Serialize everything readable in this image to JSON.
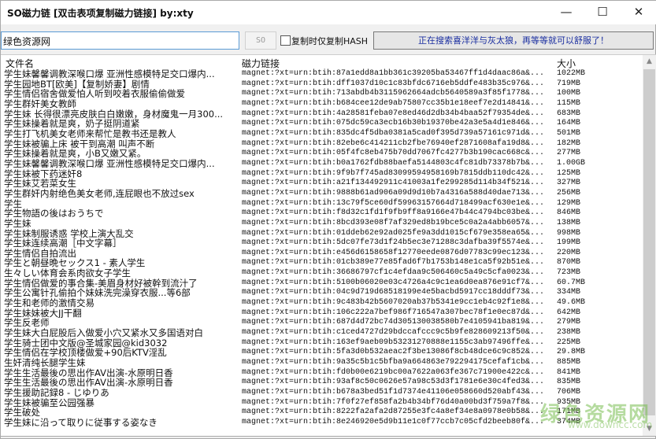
{
  "window": {
    "title": "SO磁力链 [双击表项复制磁力链接] by:xty",
    "minimize": "—",
    "maximize": "☐",
    "close": "✕"
  },
  "toolbar": {
    "search_value": "绿色资源网",
    "so_label": "SO",
    "checkbox_label": "复制时仅复制HASH",
    "checked": false,
    "status": "正在搜索喜洋洋与灰太狼，再等等就可以舒服了！"
  },
  "columns": {
    "name": "文件名",
    "magnet": "磁力链接",
    "size": "大小"
  },
  "rows": [
    {
      "name": "学生妹馨馨调教深喉口爆 亚洲性感模特足交口爆内...",
      "magnet": "magnet:?xt=urn:btih:87a1edd8a1bb361c39205ba53467ff1d4daac86a&...",
      "size": "1022MB"
    },
    {
      "name": "学生园地BT[欧美]【复制娇妻】剧情",
      "magnet": "magnet:?xt=urn:btih:dff1037d10c1c83bfdc6716eb5ddfe483b35c976&...",
      "size": "719MB"
    },
    {
      "name": "学生情侣宿舍做爱怕人听到咬着衣服偷偷做爱",
      "magnet": "magnet:?xt=urn:btih:713abdb4b3115962664adcb5640589a3f85f1778&...",
      "size": "100MB"
    },
    {
      "name": "学生群奸美女教師",
      "magnet": "magnet:?xt=urn:btih:b684cee12de9ab75807cc35b1e18eef7e2d14841&...",
      "size": "115MB"
    },
    {
      "name": "学生妹 长得很漂亮皮肤白白嫩嫩，身材魔鬼一月300...",
      "magnet": "magnet:?xt=urn:btih:4a28581feba07e8ed46d2db34b4baa52f79354de&...",
      "size": "683MB"
    },
    {
      "name": "学生妹操着就是爽，奶子挺阴道紧",
      "magnet": "magnet:?xt=urn:btih:075dc59ca3ecb16b30b19370be42a3e5a4d1e846&...",
      "size": "164MB"
    },
    {
      "name": "学生打飞机美女老师来帮忙是教书还是教人",
      "magnet": "magnet:?xt=urn:btih:835dc4f5dba0381a5cad0f395d739a57161c971d&...",
      "size": "501MB"
    },
    {
      "name": "学生妹被骗上床 被干到高潮 叫声不断",
      "magnet": "magnet:?xt=urn:btih:82ebe6c414211cb2fbe76940ef2871608afa19d8&...",
      "size": "182MB"
    },
    {
      "name": "学生妹操着就是爽，小B又嫩又紧。",
      "magnet": "magnet:?xt=urn:btih:05f4fc8eb475b70dd7067fc4277b3b190cac668c&...",
      "size": "277MB"
    },
    {
      "name": "学生妹馨馨调教深喉口爆 亚洲性感模特足交口爆内...",
      "magnet": "magnet:?xt=urn:btih:b0a1762fdb88baefa5144803c4fc81db73378b7b&...",
      "size": "1.00GB"
    },
    {
      "name": "学生妹被下药迷奸8",
      "magnet": "magnet:?xt=urn:btih:9f9b7f745ad83099594958169b7815ddb110dc42&...",
      "size": "125MB"
    },
    {
      "name": "学生妹艾若菜女生",
      "magnet": "magnet:?xt=urn:btih:a21f134492911c41003a1fe299285d114b34f521&...",
      "size": "327MB"
    },
    {
      "name": "学生群奸内射绝色美女老师,连屁眼也不放过sex",
      "magnet": "magnet:?xt=urn:btih:9888b61ad906a09d9d10b7a4316a588d40dae713&...",
      "size": "256MB"
    },
    {
      "name": "学生",
      "magnet": "magnet:?xt=urn:btih:13c79f5ce60df59963157664d718499acf630e1e&...",
      "size": "129MB"
    },
    {
      "name": "学生物語の後はおうちで",
      "magnet": "magnet:?xt=urn:btih:f8d32c1fd1f9fb9ff8a9166e47b44c4794bc03be&...",
      "size": "846MB"
    },
    {
      "name": "学生妹",
      "magnet": "magnet:?xt=urn:btih:8bcd393e08f7af329ed8b19bce5c0a2a4abb6057&...",
      "size": "138MB"
    },
    {
      "name": "学生妹制服诱惑 学校上演大乱交",
      "magnet": "magnet:?xt=urn:btih:01ddeb62e92ad025fe9a3dd1015cf679e358ea65&...",
      "size": "998MB"
    },
    {
      "name": "学生妹连续高潮［中文字幕］",
      "magnet": "magnet:?xt=urn:btih:5dc07fe73d1f24b5ec3e71288c3dafba39f5574e&...",
      "size": "199MB"
    },
    {
      "name": "学生情侣自拍流出",
      "magnet": "magnet:?xt=urn:btih:e456d6158658f12770eede0876d07783c99ec123&...",
      "size": "220MB"
    },
    {
      "name": "学生と朝昼晩セックス1 - 素人学生",
      "magnet": "magnet:?xt=urn:btih:01cb389e77e85fad6f7b1753b148e1ca5f92b51e&...",
      "size": "870MB"
    },
    {
      "name": "生々しい体育会系肉欲女子学生",
      "magnet": "magnet:?xt=urn:btih:36686797cf1c4efdaa9c506460c5a49c5cfa0023&...",
      "size": "723MB"
    },
    {
      "name": "学生情侣做爱的事合集-美眉身材好被幹到流汁了",
      "magnet": "magnet:?xt=urn:btih:5100b06020e03c4726a4c9c1ea6d0ea876e91cf7&...",
      "size": "60.7MB"
    },
    {
      "name": "学生公寓针孔偷拍个妹妹洗完澡穿衣服...等6部",
      "magnet": "magnet:?xt=urn:btih:04c9d719d68518199e4e5bacbd5917cc18dddf73&...",
      "size": "334MB"
    },
    {
      "name": "学生和老师的激情交易",
      "magnet": "magnet:?xt=urn:btih:9c483b42b5607020ab37b5341e9cc1eb4c92f1e8&...",
      "size": "49.6MB"
    },
    {
      "name": "学生妹妹被大JJ干翻",
      "magnet": "magnet:?xt=urn:btih:106c222a7bef986f716547a307bec78f1e0ec87d&...",
      "size": "642MB"
    },
    {
      "name": "学生反老师",
      "magnet": "magnet:?xt=urn:btih:687d4d72bc74d305130038580b7e4105941ba819&...",
      "size": "279MB"
    },
    {
      "name": "学生妹大白屁股后入做爱小穴又紧水又多国语对白",
      "magnet": "magnet:?xt=urn:btih:c1ced4727d29bdccafccc9c5b9fe828609213f50&...",
      "size": "238MB"
    },
    {
      "name": "学生骑士团中文版@圣城家园@kid3032",
      "magnet": "magnet:?xt=urn:btih:163ef9aeb09b53231270888e1155c3ab97496ffe&...",
      "size": "225MB"
    },
    {
      "name": "学生情侣在学校顶楼做爱+90后KTV淫乱",
      "magnet": "magnet:?xt=urn:btih:5fa3d0b532aeac2f3be13086f8cb48dce6c9c852&...",
      "size": "29.8MB"
    },
    {
      "name": "生奸清纯长腿学生妹",
      "magnet": "magnet:?xt=urn:btih:9a35c5b1c5bfba9a664863e792294175cefaf1cb&...",
      "size": "885MB"
    },
    {
      "name": "学生生活最後の思出作AV出演-水原明日香",
      "magnet": "magnet:?xt=urn:btih:fd0b00e6219bc00a7622a063fe367c71900e422c&...",
      "size": "841MB"
    },
    {
      "name": "学生生活最後の思出作AV出演-水原明日香",
      "magnet": "magnet:?xt=urn:btih:93af8c50c0626e57a98c53d3f1781e6e30c4fed3&...",
      "size": "835MB"
    },
    {
      "name": "学生援助記録8 - じゆりあ",
      "magnet": "magnet:?xt=urn:btih:b678a3bed51f1d7374e41106e058660d520abf43&...",
      "size": "706MB"
    },
    {
      "name": "学生妹被骗至公园强暴",
      "magnet": "magnet:?xt=urn:btih:7f0f27ef858fa2b4b34bf76d40a00bd3f759a7f8&...",
      "size": "935MB"
    },
    {
      "name": "学生破处",
      "magnet": "magnet:?xt=urn:btih:8222fa2afa2d87255e3fc4a8ef34e8a0978e0b58&...",
      "size": "171MB"
    },
    {
      "name": "学生妹に沿って取りに従事する姿なき",
      "magnet": "magnet:?xt=urn:btih:8e246920e5d9b11e1c0f77ccb7c05cfd2beeb80f&...",
      "size": "374MB"
    }
  ],
  "watermark": {
    "text": "绿色资源网",
    "url": "www.downcc.com"
  }
}
